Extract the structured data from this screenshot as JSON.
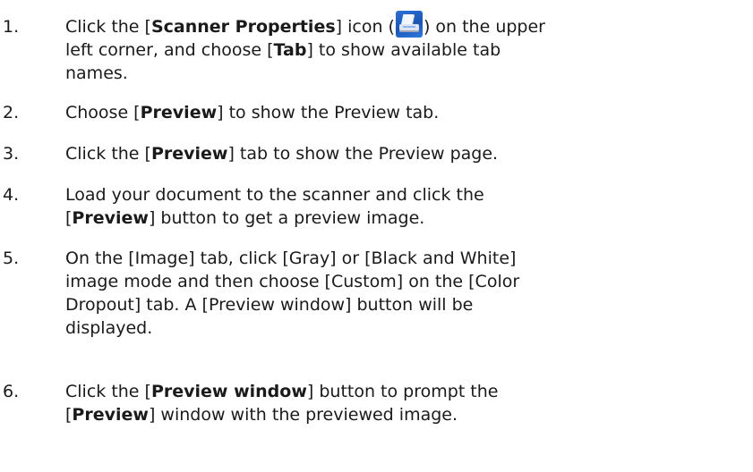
{
  "steps": [
    {
      "number": "1.",
      "lines": [
        [
          "Click the [",
          "Scanner Properties",
          "] icon (",
          "ICON",
          ") on the upper"
        ],
        [
          "left corner, and choose [",
          "Tab",
          "] to show available tab"
        ],
        [
          "names."
        ]
      ]
    },
    {
      "number": "2.",
      "lines": [
        [
          "Choose [",
          "Preview",
          "] to show the Preview tab."
        ]
      ]
    },
    {
      "number": "3.",
      "lines": [
        [
          "Click the [",
          "Preview",
          "] tab to show the Preview page."
        ]
      ]
    },
    {
      "number": "4.",
      "lines": [
        [
          "Load your document to the scanner and click the"
        ],
        [
          "[",
          "Preview",
          "] button to get a preview image."
        ]
      ]
    },
    {
      "number": "5.",
      "lines": [
        [
          "On the [Image] tab, click [Gray] or [Black and White]"
        ],
        [
          "image mode and then choose [Custom] on the [Color"
        ],
        [
          "Dropout] tab. A [Preview window] button will be"
        ],
        [
          "displayed."
        ]
      ]
    },
    {
      "number": "6.",
      "lines": [
        [
          "Click the [",
          "Preview window",
          "] button to prompt the"
        ],
        [
          "[",
          "Preview",
          "] window with the previewed image."
        ]
      ]
    }
  ],
  "icons": {
    "scanner_properties": "scanner-properties-icon"
  }
}
